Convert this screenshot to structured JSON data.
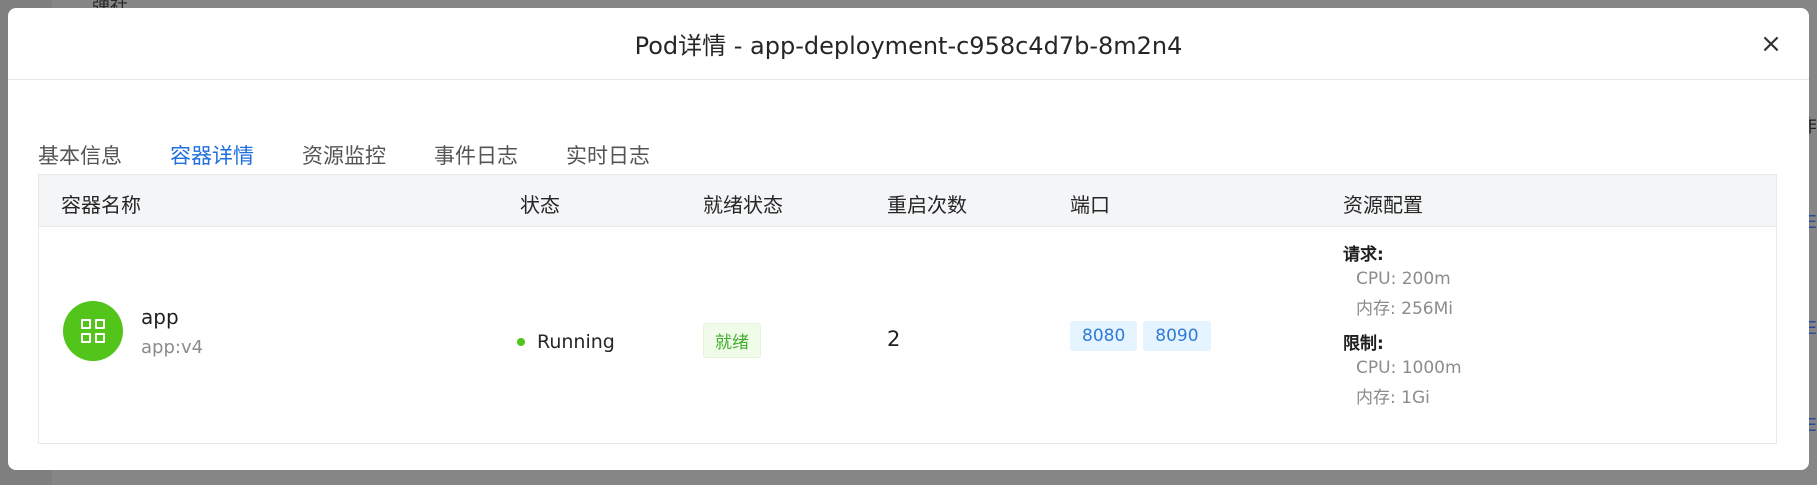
{
  "background": {
    "top_fragment": "弹社",
    "right_fragments": [
      "作",
      "E",
      "E",
      "E"
    ]
  },
  "modal": {
    "title": "Pod详情 - app-deployment-c958c4d7b-8m2n4",
    "close_symbol": "×"
  },
  "tabs": [
    {
      "label": "基本信息",
      "active": false
    },
    {
      "label": "容器详情",
      "active": true
    },
    {
      "label": "资源监控",
      "active": false
    },
    {
      "label": "事件日志",
      "active": false
    },
    {
      "label": "实时日志",
      "active": false
    }
  ],
  "table": {
    "headers": {
      "name": "容器名称",
      "status": "状态",
      "ready": "就绪状态",
      "restarts": "重启次数",
      "ports": "端口",
      "resources": "资源配置"
    },
    "rows": [
      {
        "name": "app",
        "image": "app:v4",
        "status": "Running",
        "ready": "就绪",
        "restarts": "2",
        "ports": [
          "8080",
          "8090"
        ],
        "requests_label": "请求:",
        "requests_cpu": "CPU: 200m",
        "requests_mem": "内存: 256Mi",
        "limits_label": "限制:",
        "limits_cpu": "CPU: 1000m",
        "limits_mem": "内存: 1Gi"
      }
    ]
  },
  "colors": {
    "accent": "#1f6fde",
    "running_green": "#52c41a",
    "port_tag_bg": "#e6f4ff"
  }
}
